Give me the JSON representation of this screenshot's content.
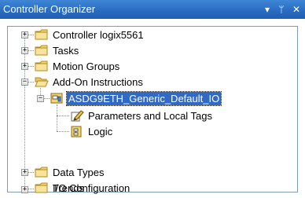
{
  "window": {
    "title": "Controller Organizer",
    "menu_glyph": "▾",
    "pin_glyph": "ᛘ",
    "close_glyph": "✕"
  },
  "tree": {
    "items": [
      {
        "label": "Controller logix5561",
        "icon": "folder-icon",
        "expanded": false
      },
      {
        "label": "Tasks",
        "icon": "folder-icon",
        "expanded": false
      },
      {
        "label": "Motion Groups",
        "icon": "folder-icon",
        "expanded": false
      },
      {
        "label": "Add-On Instructions",
        "icon": "folder-open-icon",
        "expanded": true,
        "children": [
          {
            "label": "ASDG9ETH_Generic_Default_IO",
            "icon": "aoi-icon",
            "expanded": true,
            "selected": true,
            "children": [
              {
                "label": "Parameters and Local Tags",
                "icon": "tags-pencil-icon"
              },
              {
                "label": "Logic",
                "icon": "logic-icon"
              }
            ]
          }
        ]
      },
      {
        "label": "Data Types",
        "icon": "folder-icon",
        "expanded": false
      },
      {
        "label": "Trends",
        "icon": "folder-icon"
      },
      {
        "label": "I/O Configuration",
        "icon": "folder-icon",
        "expanded": false
      }
    ]
  },
  "colors": {
    "titlebar": "#2a6cc2",
    "selection": "#316ac5",
    "folder": "#f5d76e"
  }
}
